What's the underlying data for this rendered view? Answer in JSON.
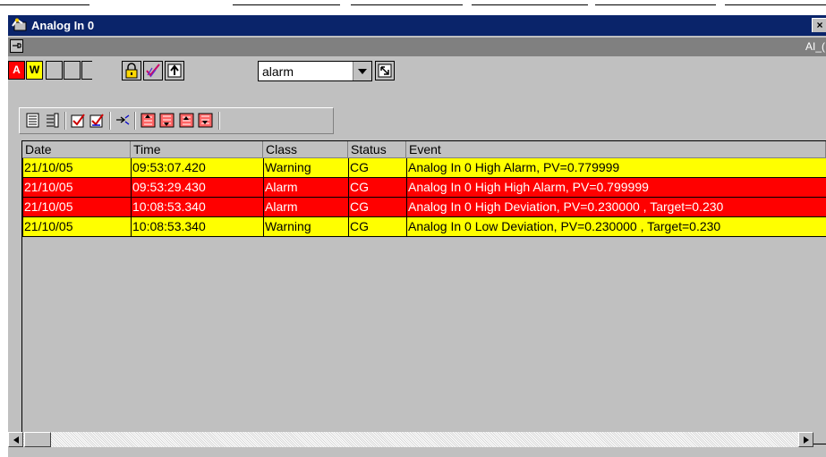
{
  "window": {
    "title": "Analog In 0",
    "close_glyph": "×",
    "identifier": "AI_("
  },
  "toolbar1": {
    "chip_alarm": "A",
    "chip_warning": "W",
    "filter_value": "alarm"
  },
  "table": {
    "headers": [
      "Date",
      "Time",
      "Class",
      "Status",
      "Event"
    ],
    "rows": [
      {
        "date": "21/10/05",
        "time": "09:53:07.420",
        "class": "Warning",
        "status": "CG",
        "event": "Analog In 0 High Alarm, PV=0.779999",
        "bg": "#ffff00",
        "fg": "#000000"
      },
      {
        "date": "21/10/05",
        "time": "09:53:29.430",
        "class": "Alarm",
        "status": "CG",
        "event": "Analog In 0 High High Alarm, PV=0.799999",
        "bg": "#ff0000",
        "fg": "#ffffff"
      },
      {
        "date": "21/10/05",
        "time": "10:08:53.340",
        "class": "Alarm",
        "status": "CG",
        "event": "Analog In 0 High Deviation, PV=0.230000  , Target=0.230",
        "bg": "#ff0000",
        "fg": "#ffffff"
      },
      {
        "date": "21/10/05",
        "time": "10:08:53.340",
        "class": "Warning",
        "status": "CG",
        "event": "Analog In 0 Low Deviation, PV=0.230000  , Target=0.230",
        "bg": "#ffff00",
        "fg": "#000000"
      }
    ]
  },
  "colors": {
    "titlebar": "#0a246a",
    "alarm": "#ff0000",
    "warning": "#ffff00",
    "panel": "#c0c0c0"
  }
}
